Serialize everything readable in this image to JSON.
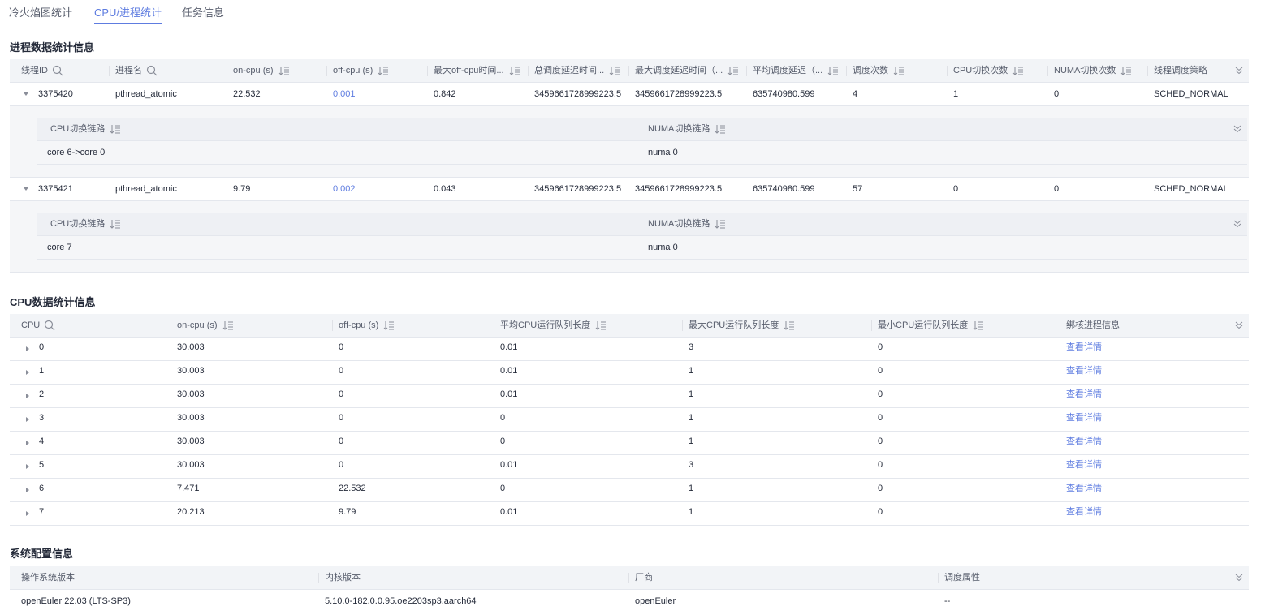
{
  "tabs": [
    "冷火焰图统计",
    "CPU/进程统计",
    "任务信息"
  ],
  "process_section": {
    "title": "进程数据统计信息",
    "headers": [
      "线程ID",
      "进程名",
      "on-cpu (s)",
      "off-cpu (s)",
      "最大off-cpu时间...",
      "总调度延迟时间...",
      "最大调度延迟时间（...",
      "平均调度延迟（...",
      "调度次数",
      "CPU切换次数",
      "NUMA切换次数",
      "线程调度策略"
    ],
    "rows": [
      {
        "cells": [
          "3375420",
          "pthread_atomic",
          "22.532",
          "0.001",
          "0.842",
          "3459661728999223.5",
          "3459661728999223.5",
          "635740980.599",
          "4",
          "1",
          "0",
          "SCHED_NORMAL"
        ],
        "sub_headers": [
          "CPU切换链路",
          "NUMA切换链路"
        ],
        "sub_values": [
          "core 6->core 0",
          "numa 0"
        ]
      },
      {
        "cells": [
          "3375421",
          "pthread_atomic",
          "9.79",
          "0.002",
          "0.043",
          "3459661728999223.5",
          "3459661728999223.5",
          "635740980.599",
          "57",
          "0",
          "0",
          "SCHED_NORMAL"
        ],
        "sub_headers": [
          "CPU切换链路",
          "NUMA切换链路"
        ],
        "sub_values": [
          "core 7",
          "numa 0"
        ]
      }
    ]
  },
  "cpu_section": {
    "title": "CPU数据统计信息",
    "headers": [
      "CPU",
      "on-cpu (s)",
      "off-cpu (s)",
      "平均CPU运行队列长度",
      "最大CPU运行队列长度",
      "最小CPU运行队列长度",
      "绑核进程信息"
    ],
    "rows": [
      [
        "0",
        "30.003",
        "0",
        "0.01",
        "3",
        "0",
        "查看详情"
      ],
      [
        "1",
        "30.003",
        "0",
        "0.01",
        "1",
        "0",
        "查看详情"
      ],
      [
        "2",
        "30.003",
        "0",
        "0.01",
        "1",
        "0",
        "查看详情"
      ],
      [
        "3",
        "30.003",
        "0",
        "0",
        "1",
        "0",
        "查看详情"
      ],
      [
        "4",
        "30.003",
        "0",
        "0",
        "1",
        "0",
        "查看详情"
      ],
      [
        "5",
        "30.003",
        "0",
        "0.01",
        "3",
        "0",
        "查看详情"
      ],
      [
        "6",
        "7.471",
        "22.532",
        "0",
        "1",
        "0",
        "查看详情"
      ],
      [
        "7",
        "20.213",
        "9.79",
        "0.01",
        "1",
        "0",
        "查看详情"
      ]
    ]
  },
  "sys_section": {
    "title": "系统配置信息",
    "headers": [
      "操作系统版本",
      "内核版本",
      "厂商",
      "调度属性"
    ],
    "rows": [
      [
        "openEuler 22.03 (LTS-SP3)",
        "5.10.0-182.0.0.95.oe2203sp3.aarch64",
        "openEuler",
        "--"
      ]
    ]
  },
  "colors": {
    "accent": "#5e7ce0",
    "header_bg": "#f2f4f7",
    "border": "#e4e7ed"
  }
}
